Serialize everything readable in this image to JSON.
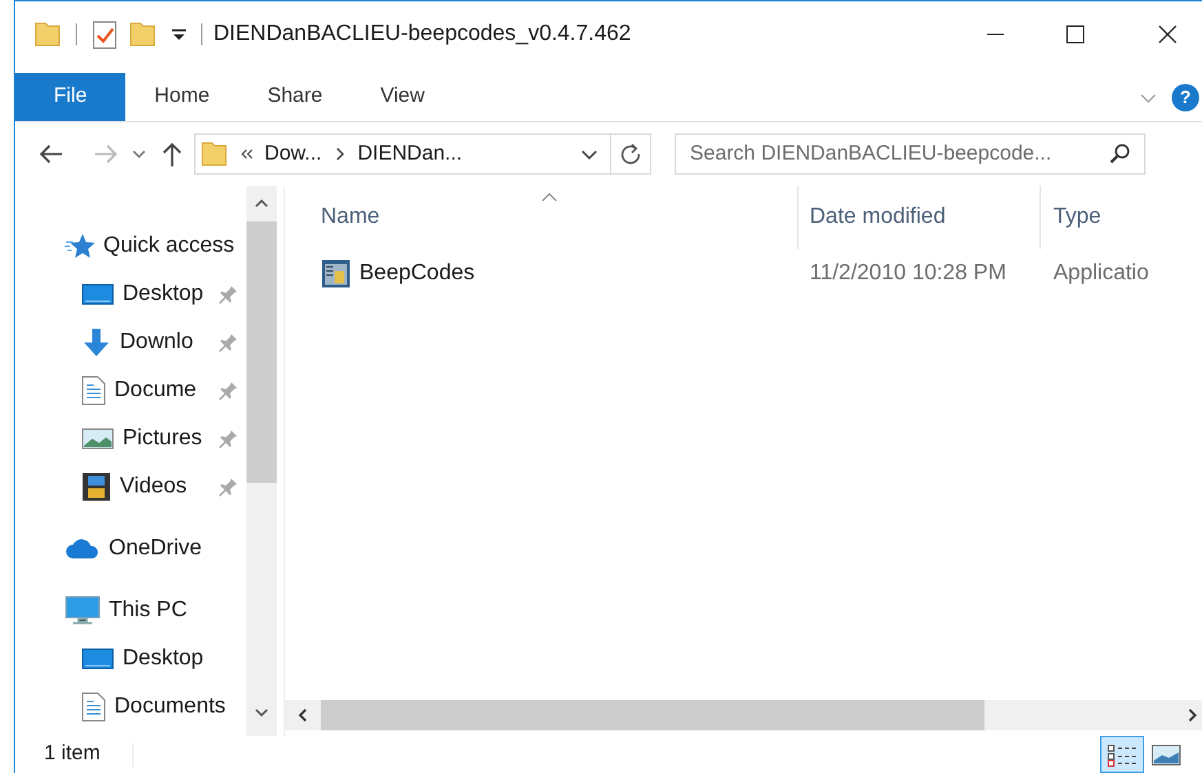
{
  "window": {
    "title": "DIENDanBACLIEU-beepcodes_v0.4.7.462"
  },
  "ribbon": {
    "tabs": [
      {
        "label": "File",
        "selected": true
      },
      {
        "label": "Home",
        "selected": false
      },
      {
        "label": "Share",
        "selected": false
      },
      {
        "label": "View",
        "selected": false
      }
    ],
    "help": "?"
  },
  "address_bar": {
    "back_disabled": false,
    "forward_disabled": true,
    "crumbs": [
      "Dow...",
      "DIENDan..."
    ]
  },
  "search": {
    "placeholder": "Search DIENDanBACLIEU-beepcode..."
  },
  "sidebar": {
    "items": [
      {
        "label": "Quick access",
        "kind": "star",
        "children": [
          {
            "label": "Desktop",
            "kind": "desktop",
            "pinned": true
          },
          {
            "label": "Downlo",
            "kind": "download",
            "pinned": true
          },
          {
            "label": "Docume",
            "kind": "document",
            "pinned": true
          },
          {
            "label": "Pictures",
            "kind": "pictures",
            "pinned": true
          },
          {
            "label": "Videos",
            "kind": "videos",
            "pinned": true
          }
        ]
      },
      {
        "label": "OneDrive",
        "kind": "cloud"
      },
      {
        "label": "This PC",
        "kind": "pc",
        "children": [
          {
            "label": "Desktop",
            "kind": "desktop",
            "pinned": false
          },
          {
            "label": "Documents",
            "kind": "document",
            "pinned": false
          }
        ]
      }
    ]
  },
  "file_list": {
    "columns": [
      {
        "label": "Name",
        "sorted": true
      },
      {
        "label": "Date modified",
        "sorted": false
      },
      {
        "label": "Type",
        "sorted": false
      }
    ],
    "rows": [
      {
        "name": "BeepCodes",
        "date_modified": "11/2/2010 10:28 PM",
        "type": "Applicatio"
      }
    ]
  },
  "status_bar": {
    "text": "1 item",
    "views": [
      {
        "kind": "details",
        "selected": true
      },
      {
        "kind": "large_icons",
        "selected": false
      }
    ]
  }
}
